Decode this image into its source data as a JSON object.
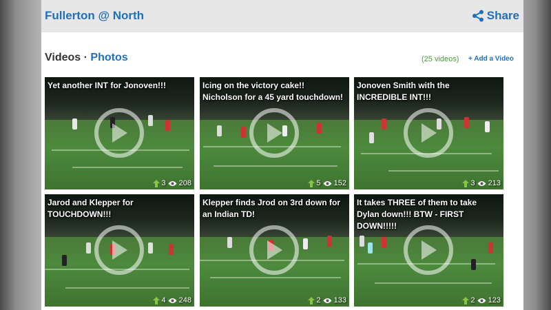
{
  "header": {
    "title": "Fullerton @ North",
    "share_label": "Share"
  },
  "section": {
    "videos_label": "Videos",
    "separator": "·",
    "photos_label": "Photos",
    "video_count": "(25 videos)",
    "add_video_label": "+ Add a Video"
  },
  "videos": [
    {
      "caption": "Yet another INT for Jonoven!!!",
      "upvotes": "3",
      "views": "208"
    },
    {
      "caption": "Icing on the victory cake!! Nicholson for a 45 yard touchdown!",
      "upvotes": "5",
      "views": "152"
    },
    {
      "caption": "Jonoven Smith with the INCREDIBLE INT!!!",
      "upvotes": "3",
      "views": "213"
    },
    {
      "caption": "Jarod and Klepper for TOUCHDOWN!!!",
      "upvotes": "4",
      "views": "248"
    },
    {
      "caption": "Klepper finds Jrod on 3rd down for an Indian TD!",
      "upvotes": "2",
      "views": "133"
    },
    {
      "caption": "It takes THREE of them to take Dylan down!!! BTW - FIRST DOWN!!!!!",
      "upvotes": "2",
      "views": "123"
    }
  ],
  "icons": {
    "share": "share-icon",
    "play": "play-icon",
    "upvote": "arrow-up-icon",
    "views": "eye-icon"
  },
  "colors": {
    "brand_blue": "#1f6fbd",
    "count_green": "#4a9a3a",
    "upvote_green": "#8bc34a"
  }
}
